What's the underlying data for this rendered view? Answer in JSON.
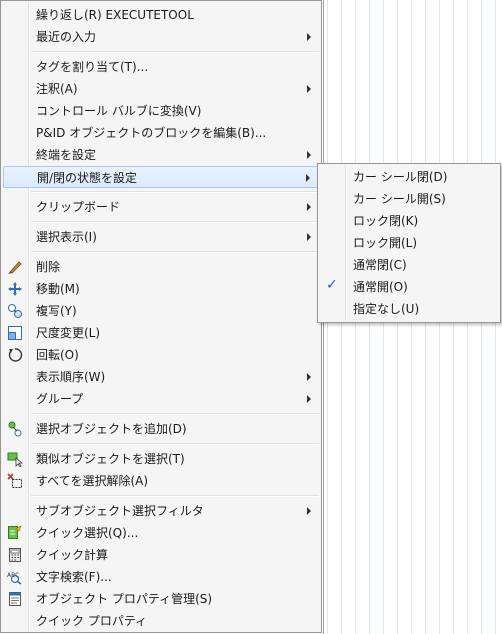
{
  "menu": {
    "items": [
      {
        "label": "繰り返し(R) EXECUTETOOL"
      },
      {
        "label": "最近の入力"
      },
      {
        "label": "タグを割り当て(T)..."
      },
      {
        "label": "注釈(A)"
      },
      {
        "label": "コントロール バルブに変換(V)"
      },
      {
        "label": "P&ID オブジェクトのブロックを編集(B)..."
      },
      {
        "label": "終端を設定"
      },
      {
        "label": "開/閉の状態を設定"
      },
      {
        "label": "クリップボード"
      },
      {
        "label": "選択表示(I)"
      },
      {
        "label": "削除"
      },
      {
        "label": "移動(M)"
      },
      {
        "label": "複写(Y)"
      },
      {
        "label": "尺度変更(L)"
      },
      {
        "label": "回転(O)"
      },
      {
        "label": "表示順序(W)"
      },
      {
        "label": "グループ"
      },
      {
        "label": "選択オブジェクトを追加(D)"
      },
      {
        "label": "類似オブジェクトを選択(T)"
      },
      {
        "label": "すべてを選択解除(A)"
      },
      {
        "label": "サブオブジェクト選択フィルタ"
      },
      {
        "label": "クイック選択(Q)..."
      },
      {
        "label": "クイック計算"
      },
      {
        "label": "文字検索(F)..."
      },
      {
        "label": "オブジェクト プロパティ管理(S)"
      },
      {
        "label": "クイック プロパティ"
      }
    ]
  },
  "submenu": {
    "items": [
      {
        "label": "カー シール閉(D)"
      },
      {
        "label": "カー シール開(S)"
      },
      {
        "label": "ロック閉(K)"
      },
      {
        "label": "ロック開(L)"
      },
      {
        "label": "通常閉(C)"
      },
      {
        "label": "通常開(O)"
      },
      {
        "label": "指定なし(U)"
      }
    ],
    "check_glyph": "✓"
  }
}
